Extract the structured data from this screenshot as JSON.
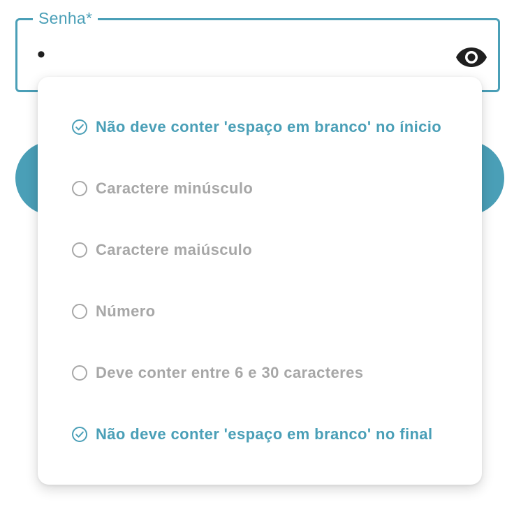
{
  "password_field": {
    "label": "Senha*",
    "value": "•",
    "toggle_icon": "eye-icon"
  },
  "submit_button": {
    "label": ""
  },
  "requirements": [
    {
      "text": "Não deve conter 'espaço em branco' no ínicio",
      "status": "ok",
      "icon": "check-circle-icon"
    },
    {
      "text": "Caractere minúsculo",
      "status": "pending",
      "icon": "empty-circle-icon"
    },
    {
      "text": "Caractere maiúsculo",
      "status": "pending",
      "icon": "empty-circle-icon"
    },
    {
      "text": "Número",
      "status": "pending",
      "icon": "empty-circle-icon"
    },
    {
      "text": "Deve conter entre 6 e 30 caracteres",
      "status": "pending",
      "icon": "empty-circle-icon"
    },
    {
      "text": "Não deve conter 'espaço em branco' no final",
      "status": "ok",
      "icon": "check-circle-icon"
    }
  ],
  "colors": {
    "accent": "#4a9fb7",
    "pending": "#a7a7a7",
    "text": "#1f1f1f"
  }
}
